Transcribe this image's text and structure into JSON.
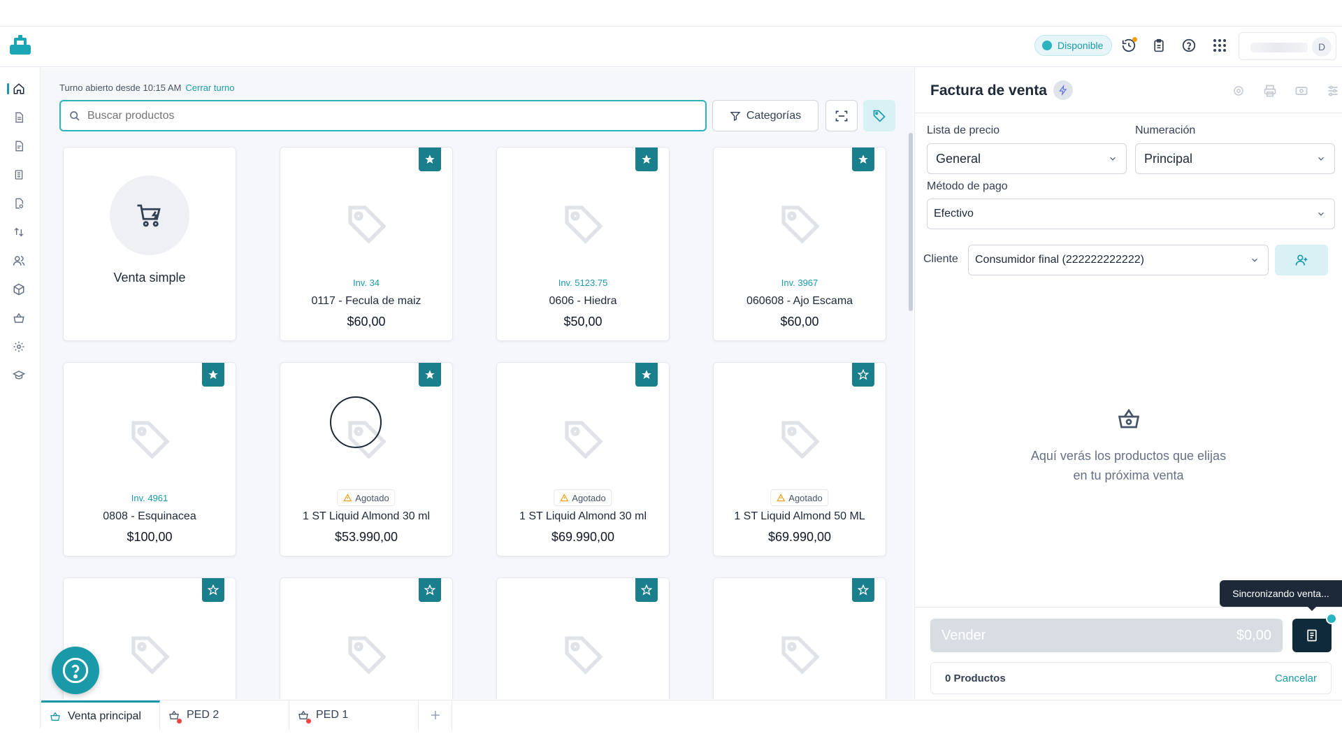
{
  "topbar": {
    "status_label": "Disponible",
    "avatar_initial": "D"
  },
  "main": {
    "shift_text": "Turno abierto desde 10:15 AM",
    "shift_link": "Cerrar turno",
    "search_placeholder": "Buscar productos",
    "categories_label": "Categorías",
    "venta_simple_label": "Venta simple",
    "products": [
      {
        "inv": "Inv. 34",
        "name": "0117 - Fecula de maiz",
        "price": "$60,00",
        "favorite": true
      },
      {
        "inv": "Inv. 5123.75",
        "name": "0606 - Hiedra",
        "price": "$50,00",
        "favorite": true
      },
      {
        "inv": "Inv. 3967",
        "name": "060608 - Ajo Escama",
        "price": "$60,00",
        "favorite": true
      },
      {
        "inv": "Inv. 4961",
        "name": "0808 - Esquinacea",
        "price": "$100,00",
        "favorite": true
      },
      {
        "badge": "Agotado",
        "name": "1 ST Liquid Almond 30 ml",
        "price": "$53.990,00",
        "favorite": true
      },
      {
        "badge": "Agotado",
        "name": "1 ST Liquid Almond 30 ml",
        "price": "$69.990,00",
        "favorite": true
      },
      {
        "badge": "Agotado",
        "name": "1 ST Liquid Almond 50 ML",
        "price": "$69.990,00",
        "favorite": false
      }
    ]
  },
  "bottom_tabs": [
    {
      "label": "Venta principal",
      "active": true
    },
    {
      "label": "PED 2",
      "active": false
    },
    {
      "label": "PED 1",
      "active": false
    }
  ],
  "panel": {
    "title": "Factura de venta",
    "price_list_label": "Lista de precio",
    "price_list_value": "General",
    "numbering_label": "Numeración",
    "numbering_value": "Principal",
    "payment_label": "Método de pago",
    "payment_value": "Efectivo",
    "client_label": "Cliente",
    "client_value": "Consumidor final (222222222222)",
    "empty_line1": "Aquí verás los productos que elijas",
    "empty_line2": "en tu próxima venta",
    "sell_label": "Vender",
    "sell_amount": "$0,00",
    "products_count": "0 Productos",
    "cancel_label": "Cancelar",
    "tooltip": "Sincronizando venta..."
  },
  "colors": {
    "accent": "#1a9aa8",
    "star_bg": "#1a7f8c",
    "dark": "#0f2a3a"
  }
}
